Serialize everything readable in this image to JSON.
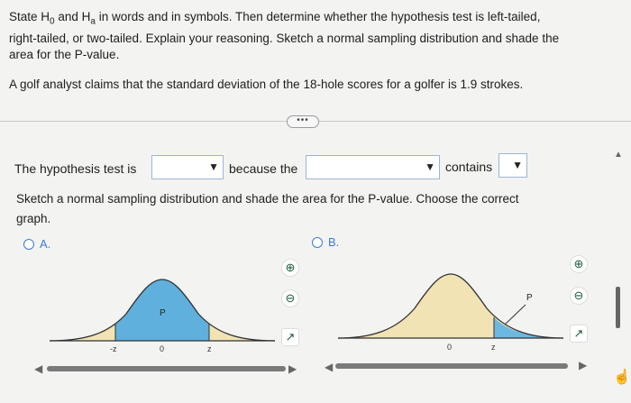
{
  "question": {
    "line1_prefix": "State H",
    "h0_sub": "0",
    "line1_and": " and H",
    "ha_sub": "a",
    "line1_rest": " in words and in symbols. Then determine whether the hypothesis test is left-tailed,",
    "line2": "right-tailed, or two-tailed. Explain your reasoning. Sketch a normal sampling distribution and shade the",
    "line3": "area for the P-value.",
    "claim": "A golf analyst claims that the standard deviation of the 18-hole scores for a golfer is 1.9 strokes."
  },
  "more_button": "•••",
  "hypothesis_row": {
    "prefix": "The hypothesis test is",
    "because": "because the",
    "contains": "contains",
    "dropdown1_value": "",
    "dropdown2_value": "",
    "dropdown3_value": ""
  },
  "sketch_prompt": {
    "line1": "Sketch a normal sampling distribution and shade the area for the P-value. Choose the correct",
    "line2": "graph."
  },
  "options": [
    {
      "label": "A.",
      "graph_labels": {
        "p": "P",
        "left": "-z",
        "center": "0",
        "right": "z"
      }
    },
    {
      "label": "B.",
      "graph_labels": {
        "p": "P",
        "center": "0",
        "right": "z"
      }
    }
  ],
  "icons": {
    "zoom_in": "zoom-in-icon",
    "zoom_out": "zoom-out-icon",
    "popout": "popout-icon"
  },
  "colors": {
    "curve_fill": "#f1e3b4",
    "shade_a": "#5fb0dc",
    "shade_b": "#6db8e0",
    "accent": "#3b7dd8"
  }
}
